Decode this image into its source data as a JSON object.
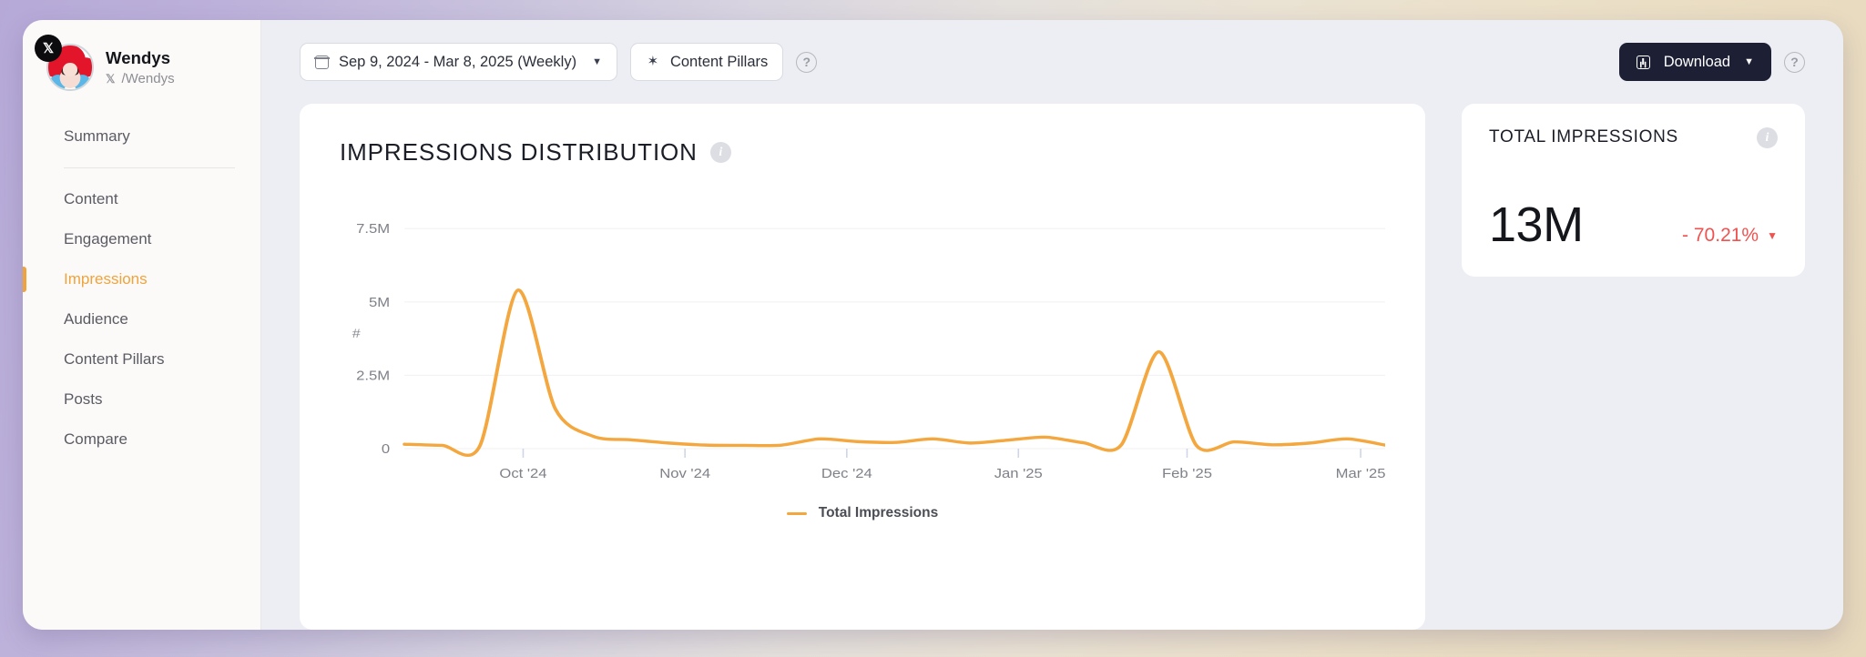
{
  "profile": {
    "name": "Wendys",
    "handle": "/Wendys",
    "network_icon": "x-logo-icon",
    "avatar_icon": "wendys-avatar"
  },
  "sidebar": {
    "items": [
      {
        "label": "Summary",
        "active": false
      },
      {
        "label": "Content",
        "active": false
      },
      {
        "label": "Engagement",
        "active": false
      },
      {
        "label": "Impressions",
        "active": true
      },
      {
        "label": "Audience",
        "active": false
      },
      {
        "label": "Content Pillars",
        "active": false
      },
      {
        "label": "Posts",
        "active": false
      },
      {
        "label": "Compare",
        "active": false
      }
    ],
    "active_color": "#f0a33a"
  },
  "toolbar": {
    "date_range": "Sep 9, 2024 - Mar 8, 2025 (Weekly)",
    "date_caret": "▼",
    "calendar_icon": "calendar-icon",
    "content_pillars": "Content Pillars",
    "sparkle_icon": "sparkle-icon",
    "help": "?",
    "download_label": "Download",
    "download_caret": "▼",
    "download_icon": "download-icon",
    "download_bg": "#1d1f35"
  },
  "chart_card": {
    "title": "IMPRESSIONS DISTRIBUTION",
    "info": "i"
  },
  "kpi": {
    "title": "TOTAL IMPRESSIONS",
    "info": "i",
    "value": "13M",
    "delta": "- 70.21%",
    "delta_caret": "▼",
    "delta_color": "#ef5350"
  },
  "chart_data": {
    "type": "line",
    "title": "IMPRESSIONS DISTRIBUTION",
    "xlabel": "",
    "ylabel": "#",
    "ylim": [
      0,
      8500000
    ],
    "ytick_values": [
      0,
      2500000,
      5000000,
      7500000
    ],
    "ytick_labels": [
      "0",
      "2.5M",
      "5M",
      "7.5M"
    ],
    "xtick_labels": [
      "Oct '24",
      "Nov '24",
      "Dec '24",
      "Jan '25",
      "Feb '25",
      "Mar '25"
    ],
    "xtick_positions": [
      0.121,
      0.286,
      0.451,
      0.626,
      0.798,
      0.975
    ],
    "grid": true,
    "legend": {
      "position": "bottom",
      "entries": [
        "Total Impressions"
      ]
    },
    "line_color": "#f3a73e",
    "series": [
      {
        "name": "Total Impressions",
        "x": [
          "Sep 9 '24",
          "Sep 16 '24",
          "Sep 23 '24",
          "Sep 30 '24",
          "Oct 7 '24",
          "Oct 14 '24",
          "Oct 21 '24",
          "Oct 28 '24",
          "Nov 4 '24",
          "Nov 11 '24",
          "Nov 18 '24",
          "Nov 25 '24",
          "Dec 2 '24",
          "Dec 9 '24",
          "Dec 16 '24",
          "Dec 23 '24",
          "Dec 30 '24",
          "Jan 6 '25",
          "Jan 13 '25",
          "Jan 20 '25",
          "Jan 27 '25",
          "Feb 3 '25",
          "Feb 10 '25",
          "Feb 17 '25",
          "Feb 24 '25",
          "Mar 3 '25",
          "Mar 8 '25"
        ],
        "values": [
          150000,
          110000,
          100000,
          5400000,
          1350000,
          420000,
          300000,
          190000,
          120000,
          110000,
          120000,
          330000,
          240000,
          210000,
          330000,
          190000,
          290000,
          390000,
          200000,
          120000,
          3300000,
          100000,
          230000,
          130000,
          190000,
          330000,
          120000
        ]
      }
    ]
  }
}
